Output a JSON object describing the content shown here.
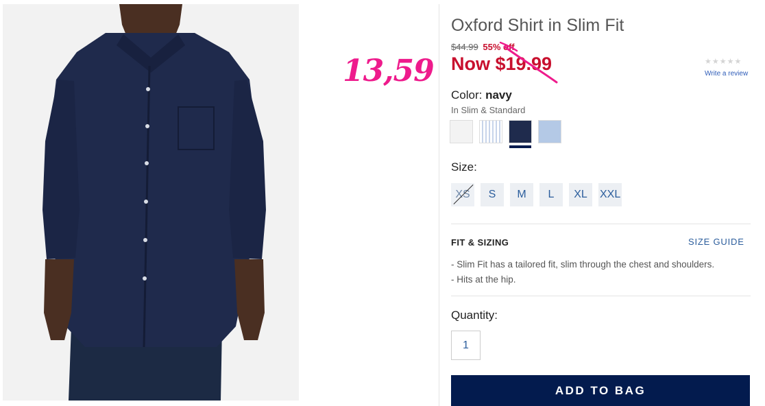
{
  "product": {
    "title": "Oxford Shirt in Slim Fit",
    "old_price": "$44.99",
    "discount": "55% off",
    "now_price": "Now $19.99",
    "handwritten_price": "13,59",
    "rating_stars": "★★★★★",
    "write_review": "Write a review"
  },
  "color": {
    "label": "Color:",
    "value": "navy",
    "fit_note": "In Slim & Standard",
    "swatches": [
      {
        "name": "white",
        "hex": "#f3f3f3"
      },
      {
        "name": "blue-stripe",
        "hex": "#c7d4ea"
      },
      {
        "name": "navy",
        "hex": "#1f2b4d",
        "selected": true
      },
      {
        "name": "light-blue",
        "hex": "#b4c9e6"
      }
    ]
  },
  "size": {
    "label": "Size:",
    "options": [
      {
        "label": "XS",
        "available": false
      },
      {
        "label": "S",
        "available": true
      },
      {
        "label": "M",
        "available": true
      },
      {
        "label": "L",
        "available": true
      },
      {
        "label": "XL",
        "available": true
      },
      {
        "label": "XXL",
        "available": true
      }
    ]
  },
  "fit": {
    "title": "FIT & SIZING",
    "size_guide": "SIZE GUIDE",
    "bullets": [
      "- Slim Fit has a tailored fit, slim through the chest and shoulders.",
      "- Hits at the hip."
    ]
  },
  "quantity": {
    "label": "Quantity:",
    "value": "1"
  },
  "cta": {
    "add_to_bag": "ADD TO BAG"
  },
  "colors": {
    "brand_navy": "#031b4e",
    "sale_red": "#c8102e",
    "annotation_pink": "#ee1b8c",
    "link_blue": "#2b5d9c"
  }
}
